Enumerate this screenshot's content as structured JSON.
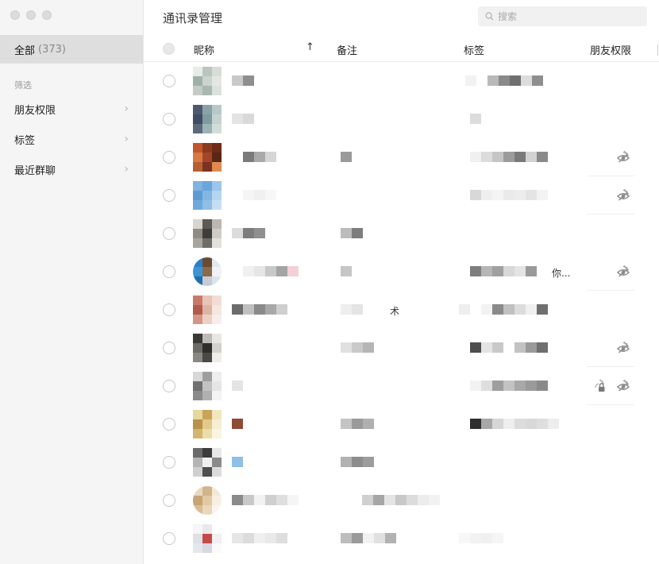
{
  "window": {
    "title": "通讯录管理"
  },
  "search": {
    "placeholder": "搜索"
  },
  "sidebar": {
    "all_label": "全部",
    "all_count": "(373)",
    "filter_heading": "筛选",
    "items": [
      {
        "label": "朋友权限"
      },
      {
        "label": "标签"
      },
      {
        "label": "最近群聊"
      }
    ]
  },
  "table": {
    "columns": [
      "昵称",
      "备注",
      "标签",
      "朋友权限"
    ],
    "sort_indicator": "↑",
    "rows": [
      {
        "nickname": "",
        "remark": "",
        "tags": "",
        "perm_icons": []
      },
      {
        "nickname": "",
        "remark": "",
        "tags": "",
        "perm_icons": []
      },
      {
        "nickname": "",
        "remark": "",
        "tags": "",
        "perm_icons": [
          "hidden-eye-icon"
        ]
      },
      {
        "nickname": "",
        "remark": "",
        "tags": "",
        "perm_icons": [
          "hidden-eye-icon"
        ]
      },
      {
        "nickname": "",
        "remark": "",
        "tags": "",
        "perm_icons": []
      },
      {
        "nickname": "",
        "remark": "",
        "tags": "你...",
        "perm_icons": [
          "hidden-eye-icon"
        ]
      },
      {
        "nickname": "",
        "remark": "术",
        "tags": "",
        "perm_icons": []
      },
      {
        "nickname": "",
        "remark": "",
        "tags": "",
        "perm_icons": [
          "hidden-eye-icon"
        ]
      },
      {
        "nickname": "",
        "remark": "",
        "tags": "",
        "perm_icons": [
          "lock-icon",
          "hidden-eye-icon"
        ]
      },
      {
        "nickname": "",
        "remark": "",
        "tags": "",
        "perm_icons": []
      },
      {
        "nickname": "",
        "remark": "",
        "tags": "",
        "perm_icons": []
      },
      {
        "nickname": "",
        "remark": "",
        "tags": "",
        "perm_icons": []
      },
      {
        "nickname": "",
        "remark": "",
        "tags": "",
        "perm_icons": []
      }
    ]
  },
  "colors": {
    "sidebar_bg": "#f5f5f5",
    "selected_bg": "#dedede",
    "perm_icon": "#9a9a9a"
  }
}
